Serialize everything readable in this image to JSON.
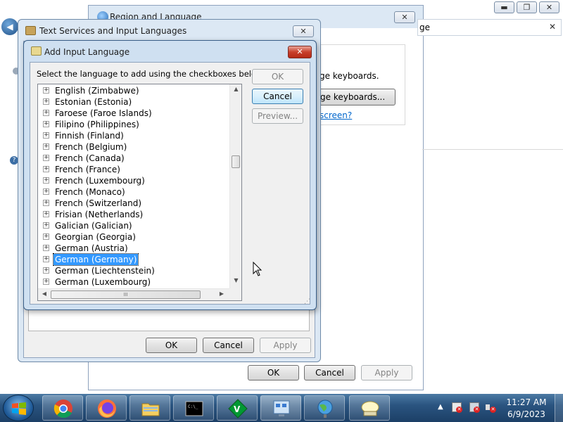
{
  "region_window": {
    "title": "Region and Language",
    "search_fragment": "ge",
    "keyboards_text": "ge keyboards.",
    "change_keyboards_button": "ge keyboards...",
    "screen_link": "screen?",
    "ok": "OK",
    "cancel": "Cancel",
    "apply": "Apply"
  },
  "text_services_window": {
    "title": "Text Services and Input Languages",
    "ok": "OK",
    "cancel": "Cancel",
    "apply": "Apply"
  },
  "add_dialog": {
    "title": "Add Input Language",
    "instruction": "Select the language to add using the checkboxes below.",
    "ok": "OK",
    "cancel": "Cancel",
    "preview": "Preview...",
    "languages": [
      "English (Zimbabwe)",
      "Estonian (Estonia)",
      "Faroese (Faroe Islands)",
      "Filipino (Philippines)",
      "Finnish (Finland)",
      "French (Belgium)",
      "French (Canada)",
      "French (France)",
      "French (Luxembourg)",
      "French (Monaco)",
      "French (Switzerland)",
      "Frisian (Netherlands)",
      "Galician (Galician)",
      "Georgian (Georgia)",
      "German (Austria)",
      "German (Germany)",
      "German (Liechtenstein)",
      "German (Luxembourg)"
    ],
    "selected_language": "German (Germany)",
    "scroll_grip": "III"
  },
  "taskbar": {
    "time": "11:27 AM",
    "date": "6/9/2023"
  },
  "colors": {
    "selection": "#3399ff",
    "link": "#0066cc",
    "taskbar": "#2a5480"
  }
}
